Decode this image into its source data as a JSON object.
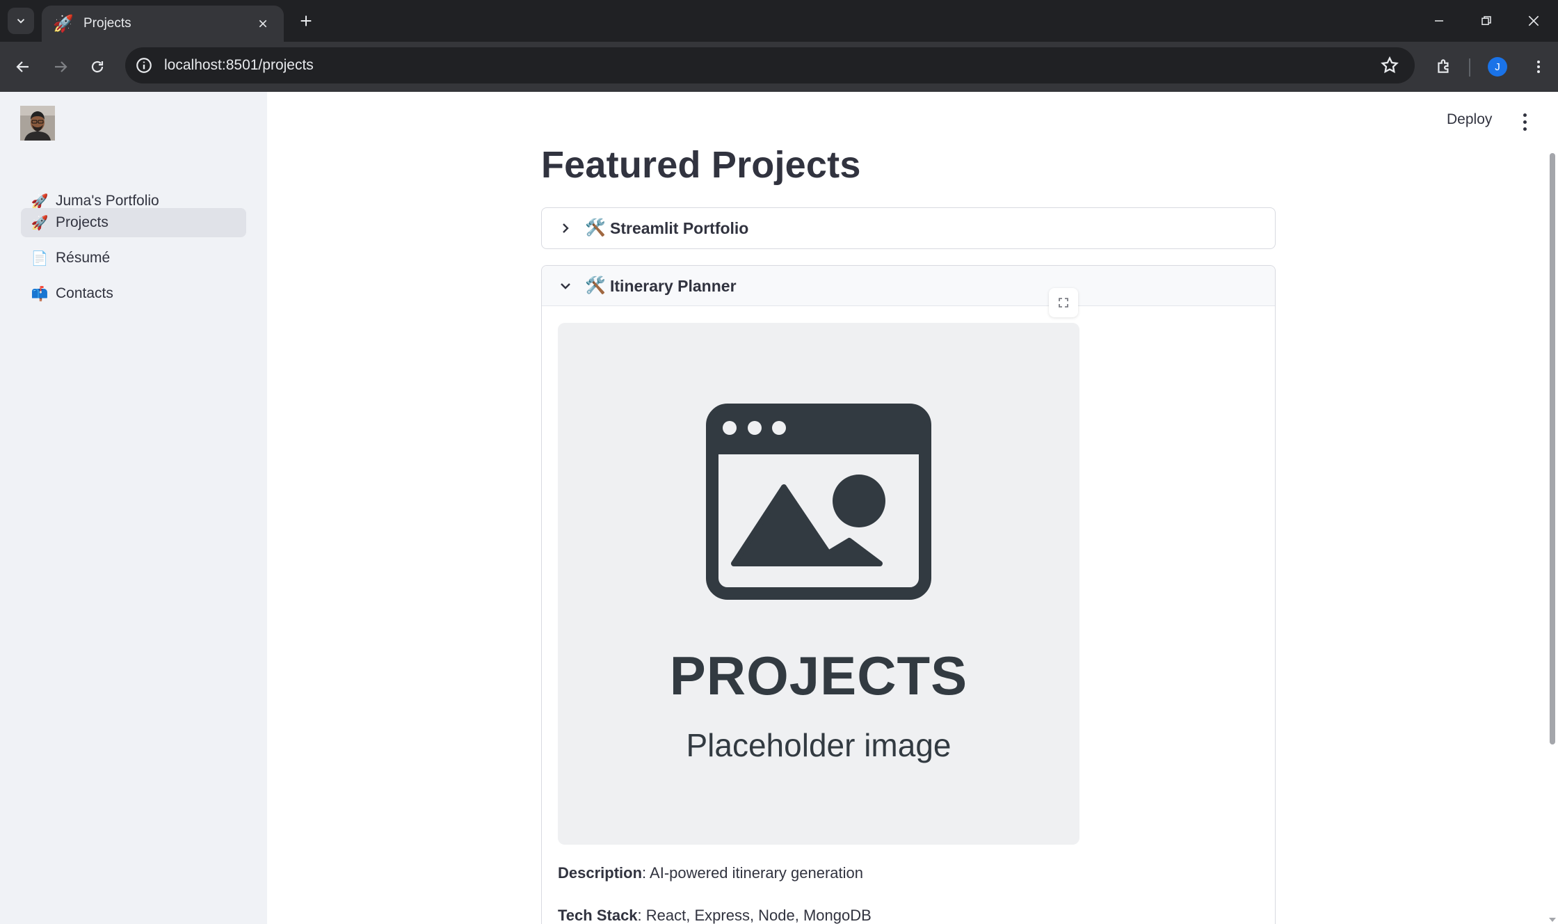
{
  "browser": {
    "tab_title": "Projects",
    "tab_favicon": "🚀",
    "url": "localhost:8501/projects",
    "profile_initial": "J",
    "accent": "#1a73e8"
  },
  "sidebar": {
    "items": [
      {
        "emoji": "🚀",
        "label": "Juma's Portfolio",
        "active": false
      },
      {
        "emoji": "🚀",
        "label": "Projects",
        "active": true
      },
      {
        "emoji": "📄",
        "label": "Résumé",
        "active": false
      },
      {
        "emoji": "📫",
        "label": "Contacts",
        "active": false
      }
    ]
  },
  "header": {
    "deploy_label": "Deploy"
  },
  "main": {
    "title": "Featured Projects",
    "expanders": [
      {
        "emoji": "🛠️",
        "label": "Streamlit Portfolio",
        "expanded": false
      },
      {
        "emoji": "🛠️",
        "label": "Itinerary Planner",
        "expanded": true
      }
    ],
    "placeholder": {
      "title": "PROJECTS",
      "subtitle": "Placeholder image"
    },
    "description": {
      "label": "Description",
      "value": ": AI-powered itinerary generation"
    },
    "tech_stack": {
      "label": "Tech Stack",
      "value": ": React, Express, Node, MongoDB"
    }
  }
}
